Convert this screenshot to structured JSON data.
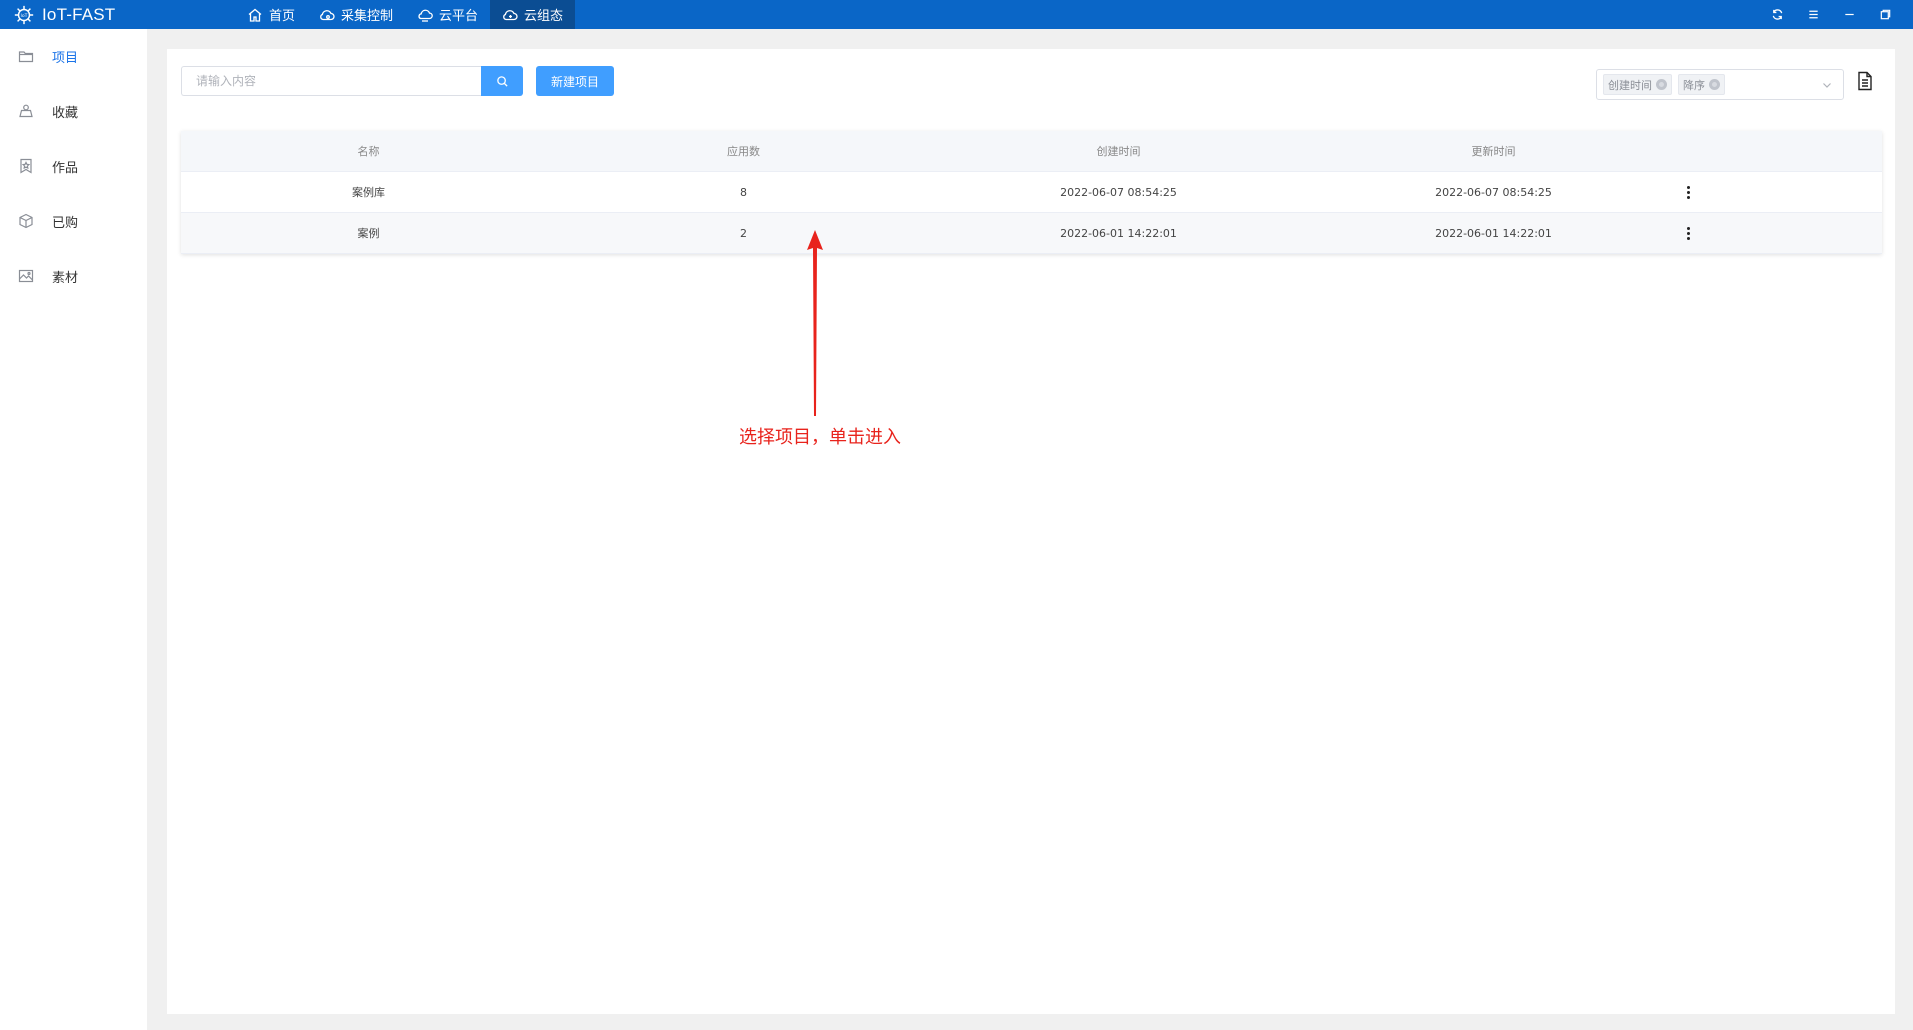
{
  "app": {
    "title": "IoT-FAST"
  },
  "nav": {
    "tabs": [
      {
        "label": "首页",
        "icon": "home-icon"
      },
      {
        "label": "采集控制",
        "icon": "cloud-gear-icon"
      },
      {
        "label": "云平台",
        "icon": "cloud-platform-icon"
      },
      {
        "label": "云组态",
        "icon": "cloud-config-icon",
        "active": true
      }
    ]
  },
  "window_controls": [
    "refresh-icon",
    "menu-icon",
    "minimize-icon",
    "restore-icon"
  ],
  "sidebar": {
    "items": [
      {
        "label": "项目",
        "icon": "folder-icon",
        "active": true
      },
      {
        "label": "收藏",
        "icon": "collect-icon"
      },
      {
        "label": "作品",
        "icon": "bookmark-star-icon"
      },
      {
        "label": "已购",
        "icon": "box-icon"
      },
      {
        "label": "素材",
        "icon": "image-icon"
      }
    ]
  },
  "toolbar": {
    "search_placeholder": "请输入内容",
    "new_project_label": "新建项目",
    "sort_tags": [
      "创建时间",
      "降序"
    ]
  },
  "table": {
    "headers": [
      "名称",
      "应用数",
      "创建时间",
      "更新时间"
    ],
    "rows": [
      {
        "name": "案例库",
        "apps": "8",
        "created": "2022-06-07 08:54:25",
        "updated": "2022-06-07 08:54:25"
      },
      {
        "name": "案例",
        "apps": "2",
        "created": "2022-06-01 14:22:01",
        "updated": "2022-06-01 14:22:01"
      }
    ]
  },
  "annotation": {
    "text": "选择项目，单击进入",
    "color": "#e8231c"
  },
  "colors": {
    "topbar": "#0a66c7",
    "active_tab": "#0b4d93",
    "primary": "#409eff",
    "sidebar_active": "#1a73e8"
  }
}
